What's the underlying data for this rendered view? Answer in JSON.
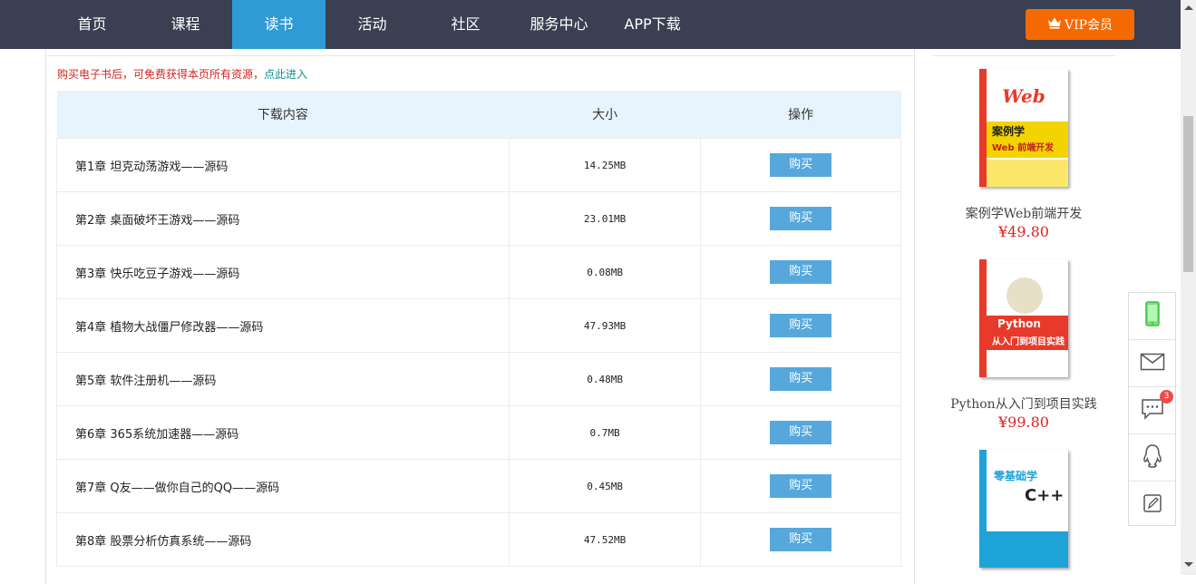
{
  "nav": {
    "items": [
      {
        "label": "首页"
      },
      {
        "label": "课程"
      },
      {
        "label": "读书",
        "active": true
      },
      {
        "label": "活动"
      },
      {
        "label": "社区"
      },
      {
        "label": "服务中心"
      },
      {
        "label": "APP下载"
      }
    ],
    "vip_label": "VIP会员"
  },
  "notice": {
    "text": "购买电子书后，可免费获得本页所有资源，",
    "link": "点此进入"
  },
  "table": {
    "headers": {
      "content": "下载内容",
      "size": "大小",
      "action": "操作"
    },
    "rows": [
      {
        "name": "第1章 坦克动荡游戏——源码",
        "size": "14.25MB",
        "action": "购买"
      },
      {
        "name": "第2章 桌面破坏王游戏——源码",
        "size": "23.01MB",
        "action": "购买"
      },
      {
        "name": "第3章 快乐吃豆子游戏——源码",
        "size": "0.08MB",
        "action": "购买"
      },
      {
        "name": "第4章 植物大战僵尸修改器——源码",
        "size": "47.93MB",
        "action": "购买"
      },
      {
        "name": "第5章 软件注册机——源码",
        "size": "0.48MB",
        "action": "购买"
      },
      {
        "name": "第6章 365系统加速器——源码",
        "size": "0.7MB",
        "action": "购买"
      },
      {
        "name": "第7章 Q友——做你自己的QQ——源码",
        "size": "0.45MB",
        "action": "购买"
      },
      {
        "name": "第8章 股票分析仿真系统——源码",
        "size": "47.52MB",
        "action": "购买"
      }
    ]
  },
  "sidebar": {
    "books": [
      {
        "title": "案例学Web前端开发",
        "price": "¥49.80",
        "cover_text": "案例学",
        "cover_sub": "Web 前端开发"
      },
      {
        "title": "Python从入门到项目实践",
        "price": "¥99.80",
        "cover_text": "Python",
        "cover_sub": "从入门到项目实践"
      },
      {
        "title": "",
        "price": "",
        "cover_text": "零基础学",
        "cover_sub": "C++"
      }
    ]
  },
  "float_bar": {
    "items": [
      {
        "icon": "phone-icon"
      },
      {
        "icon": "mail-icon"
      },
      {
        "icon": "chat-icon",
        "badge": "3"
      },
      {
        "icon": "qq-icon"
      },
      {
        "icon": "edit-icon"
      }
    ]
  },
  "colors": {
    "navbar": "#3a3f51",
    "nav_active": "#2f9bd5",
    "vip": "#f56a00",
    "buy_button": "#56a8dc",
    "price": "#e02020",
    "notice": "#d0261f"
  }
}
